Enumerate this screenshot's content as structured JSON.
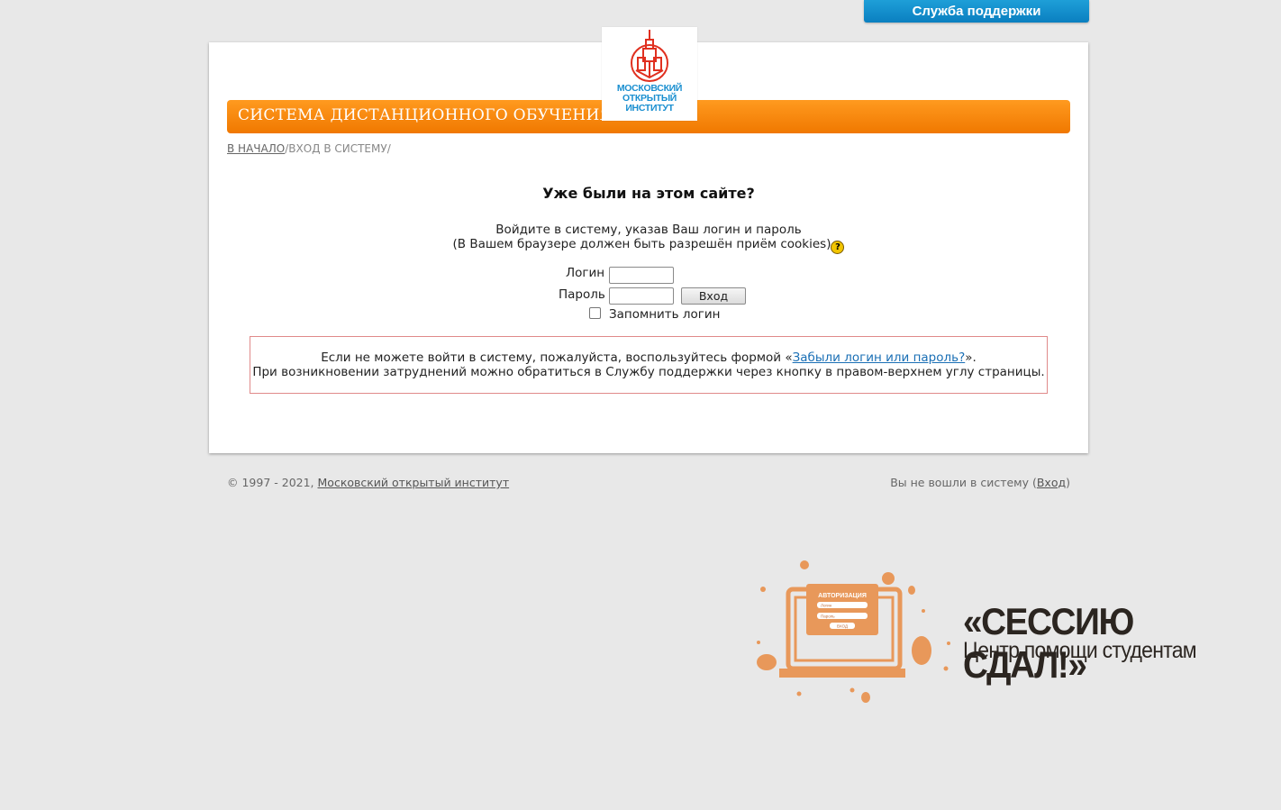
{
  "support": {
    "label": "Служба поддержки"
  },
  "header": {
    "title": "СИСТЕМА ДИСТАНЦИОННОГО ОБУЧЕНИЯ",
    "logo_lines": [
      "МОСКОВСКИЙ",
      "ОТКРЫТЫЙ",
      "ИНСТИТУТ"
    ]
  },
  "breadcrumb": {
    "home": "В НАЧАЛО",
    "sep1": "/",
    "current": "ВХОД В СИСТЕМУ",
    "sep2": "/"
  },
  "login": {
    "heading": "Уже были на этом сайте?",
    "intro_line1": "Войдите в систему, указав Ваш логин и пароль",
    "intro_line2": "(В Вашем браузере должен быть разрешён приём cookies)",
    "help_icon_glyph": "?",
    "username_label": "Логин",
    "username_value": "",
    "password_label": "Пароль",
    "password_value": "",
    "submit_label": "Вход",
    "remember_label": "Запомнить логин"
  },
  "notice": {
    "line1_before": "Если не можете войти в систему, пожалуйста, воспользуйтесь формой «",
    "line1_link": "Забыли логин или пароль?",
    "line1_after": "».",
    "line2": "При возникновении затруднений можно обратиться в Службу поддержки через кнопку в правом-верхнем углу страницы."
  },
  "footer": {
    "copyright": "© 1997 - 2021, ",
    "institute_link": "Московский открытый институт",
    "status_before": "Вы не вошли в систему (",
    "login_link": "Вход",
    "status_after": ")"
  },
  "promo": {
    "title": "«СЕССИЮ СДАЛ!»",
    "subtitle": "Центр помощи студентам",
    "art_header": "АВТОРИЗАЦИЯ",
    "art_field1": "Логин",
    "art_field2": "Пароль",
    "art_button": "ВХОД"
  },
  "colors": {
    "accent_orange": "#f58200",
    "support_blue": "#0a8cd0",
    "notice_border": "#e08a8a",
    "promo_orange": "#e8985a"
  }
}
